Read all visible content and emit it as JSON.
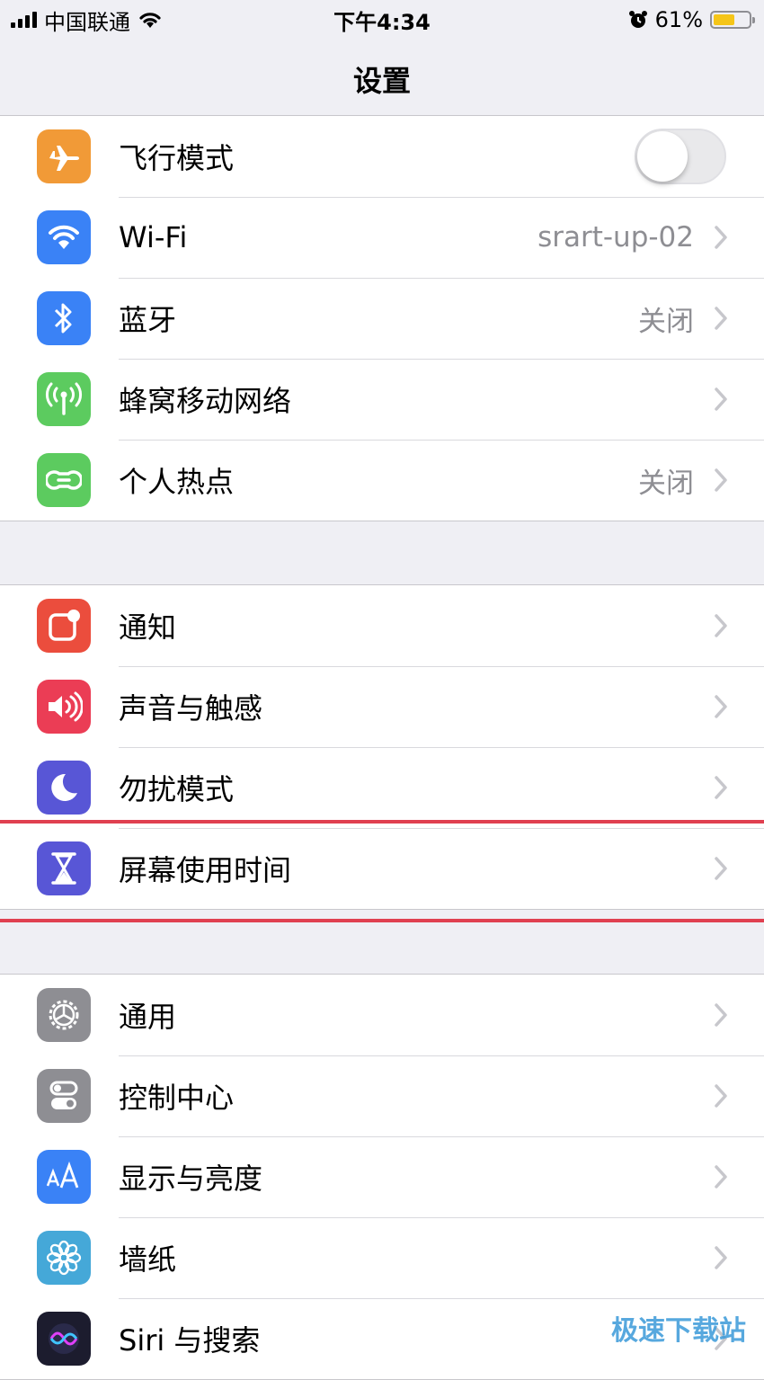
{
  "status": {
    "carrier": "中国联通",
    "time": "下午4:34",
    "battery": "61%",
    "battery_level": 0.61
  },
  "nav": {
    "title": "设置"
  },
  "groups": [
    [
      {
        "label": "飞行模式",
        "value": "",
        "icon": "airplane-icon",
        "color": "#f19a37",
        "toggle": false
      },
      {
        "label": "Wi-Fi",
        "value": "srart-up-02",
        "icon": "wifi-icon",
        "color": "#3a82f6"
      },
      {
        "label": "蓝牙",
        "value": "关闭",
        "icon": "bluetooth-icon",
        "color": "#3a82f6"
      },
      {
        "label": "蜂窝移动网络",
        "value": "",
        "icon": "cellular-icon",
        "color": "#5ccb5f"
      },
      {
        "label": "个人热点",
        "value": "关闭",
        "icon": "hotspot-icon",
        "color": "#5ccb5f"
      }
    ],
    [
      {
        "label": "通知",
        "value": "",
        "icon": "notification-icon",
        "color": "#eb4d3d"
      },
      {
        "label": "声音与触感",
        "value": "",
        "icon": "speaker-icon",
        "color": "#eb3d55"
      },
      {
        "label": "勿扰模式",
        "value": "",
        "icon": "moon-icon",
        "color": "#5856d6"
      },
      {
        "label": "屏幕使用时间",
        "value": "",
        "icon": "hourglass-icon",
        "color": "#5856d6"
      }
    ],
    [
      {
        "label": "通用",
        "value": "",
        "icon": "gear-icon",
        "color": "#8e8e93"
      },
      {
        "label": "控制中心",
        "value": "",
        "icon": "switches-icon",
        "color": "#8e8e93"
      },
      {
        "label": "显示与亮度",
        "value": "",
        "icon": "text-size-icon",
        "color": "#3a82f6"
      },
      {
        "label": "墙纸",
        "value": "",
        "icon": "flower-icon",
        "color": "#45a8d8"
      },
      {
        "label": "Siri 与搜索",
        "value": "",
        "icon": "siri-icon",
        "color": "#222"
      }
    ]
  ],
  "watermark": "极速下载站"
}
